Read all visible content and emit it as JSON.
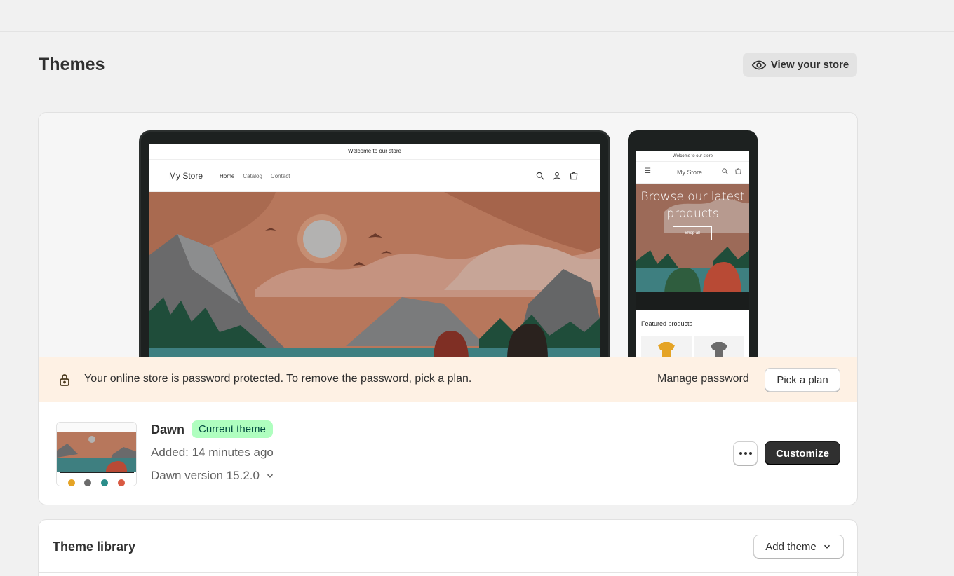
{
  "header": {
    "title": "Themes",
    "view_store_label": "View your store"
  },
  "preview": {
    "desktop": {
      "announcement": "Welcome to our store",
      "store_name": "My Store",
      "nav_links": [
        "Home",
        "Catalog",
        "Contact"
      ]
    },
    "mobile": {
      "announcement": "Welcome to our store",
      "store_name": "My Store",
      "hero_text": "Browse our latest products",
      "shop_button": "Shop all",
      "featured_heading": "Featured products"
    }
  },
  "password_banner": {
    "message": "Your online store is password protected. To remove the password, pick a plan.",
    "manage_label": "Manage password",
    "pick_plan_label": "Pick a plan"
  },
  "current_theme": {
    "name": "Dawn",
    "badge": "Current theme",
    "added": "Added: 14 minutes ago",
    "version": "Dawn version 15.2.0",
    "customize_label": "Customize"
  },
  "library": {
    "title": "Theme library",
    "add_theme_label": "Add theme"
  },
  "colors": {
    "badge_bg": "#affebf",
    "banner_bg": "#fef1e4",
    "primary_button": "#303030"
  }
}
